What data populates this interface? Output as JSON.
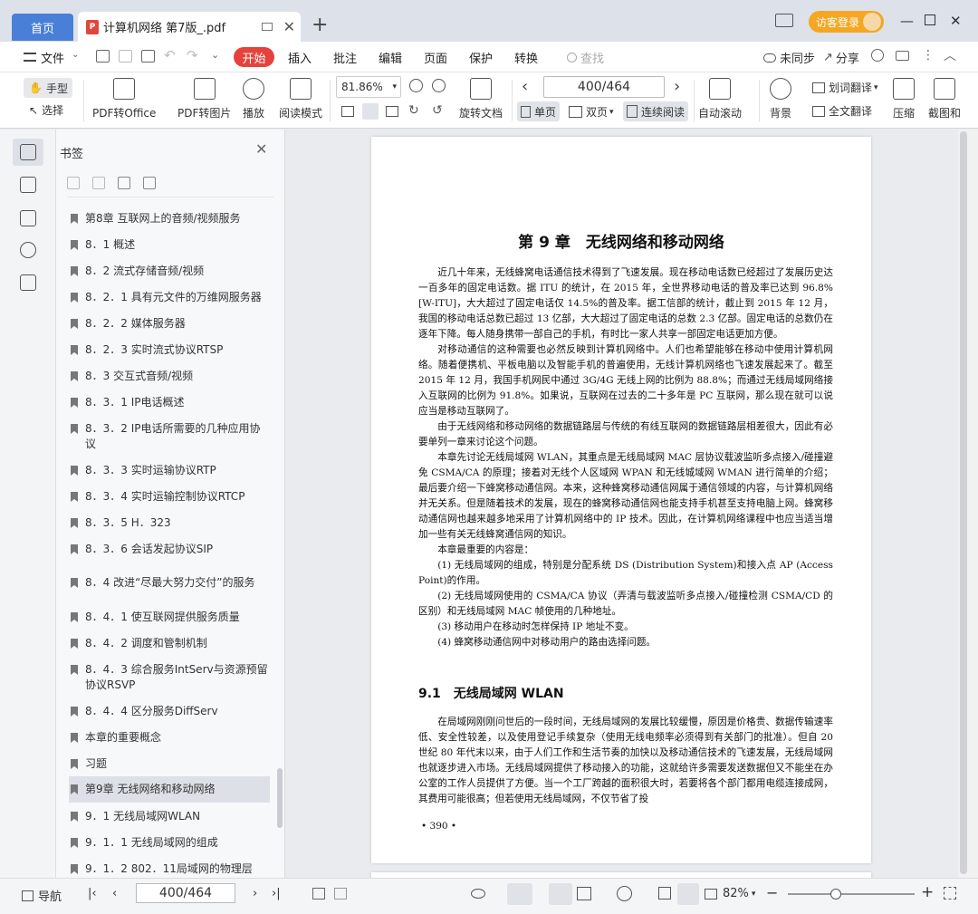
{
  "titlebar": {
    "home_tab": "首页",
    "doc_tab": "计算机网络 第7版_.pdf",
    "visitor_login": "访客登录"
  },
  "menubar": {
    "file": "文件",
    "items": [
      "开始",
      "插入",
      "批注",
      "编辑",
      "页面",
      "保护",
      "转换"
    ],
    "search_placeholder": "查找",
    "sync": "未同步",
    "share": "分享"
  },
  "toolbar": {
    "hand": "手型",
    "select": "选择",
    "pdf_to_office": "PDF转Office",
    "pdf_to_image": "PDF转图片",
    "play": "播放",
    "reading_mode": "阅读模式",
    "zoom": "81.86%",
    "rotate": "旋转文档",
    "page_indicator": "400/464",
    "single_page": "单页",
    "double_page": "双页",
    "continuous": "连续阅读",
    "auto_scroll": "自动滚动",
    "background": "背景",
    "word_translate": "划词翻译",
    "full_translate": "全文翻译",
    "compress": "压缩",
    "screenshot": "截图和"
  },
  "bookmarks": {
    "title": "书签",
    "items": [
      "第8章 互联网上的音频/视频服务",
      "8．1 概述",
      "8．2 流式存储音频/视频",
      "8．2．1 具有元文件的万维网服务器",
      "8．2．2 媒体服务器",
      "8．2．3 实时流式协议RTSP",
      "8．3 交互式音频/视频",
      "8．3．1 IP电话概述",
      "8．3．2 IP电话所需要的几种应用协议",
      "8．3．3 实时运输协议RTP",
      "8．3．4 实时运输控制协议RTCP",
      "8．3．5 H．323",
      "8．3．6 会话发起协议SIP",
      "8．4 改进“尽最大努力交付”的服务",
      "8．4．1 使互联网提供服务质量",
      "8．4．2 调度和管制机制",
      "8．4．3 综合服务IntServ与资源预留协议RSVP",
      "8．4．4 区分服务DiffServ",
      "本章的重要概念",
      "习题",
      "第9章 无线网络和移动网络",
      "9．1 无线局域网WLAN",
      "9．1．1 无线局域网的组成",
      "9．1．2 802．11局域网的物理层"
    ],
    "selected_index": 20
  },
  "document": {
    "chapter_title": "第 9 章　无线网络和移动网络",
    "paragraphs": [
      "近几十年来，无线蜂窝电话通信技术得到了飞速发展。现在移动电话数已经超过了发展历史达一百多年的固定电话数。据 ITU 的统计，在 2015 年，全世界移动电话的普及率已达到 96.8%[W-ITU]，大大超过了固定电话仅 14.5%的普及率。据工信部的统计，截止到 2015 年 12 月，我国的移动电话总数已超过 13 亿部，大大超过了固定电话的总数 2.3 亿部。固定电话的总数仍在逐年下降。每人随身携带一部自己的手机，有时比一家人共享一部固定电话更加方便。",
      "对移动通信的这种需要也必然反映到计算机网络中。人们也希望能够在移动中使用计算机网络。随着便携机、平板电脑以及智能手机的普遍使用，无线计算机网络也飞速发展起来了。截至 2015 年 12 月，我国手机网民中通过 3G/4G 无线上网的比例为 88.8%；而通过无线局域网络接入互联网的比例为 91.8%。如果说，互联网在过去的二十多年是 PC 互联网，那么现在就可以说应当是移动互联网了。",
      "由于无线网络和移动网络的数据链路层与传统的有线互联网的数据链路层相差很大，因此有必要单列一章来讨论这个问题。",
      "本章先讨论无线局域网 WLAN，其重点是无线局域网 MAC 层协议载波监听多点接入/碰撞避免 CSMA/CA 的原理；接着对无线个人区域网 WPAN 和无线城域网 WMAN 进行简单的介绍；最后要介绍一下蜂窝移动通信网。本来，这种蜂窝移动通信网属于通信领域的内容，与计算机网络并无关系。但是随着技术的发展，现在的蜂窝移动通信网也能支持手机甚至支持电脑上网。蜂窝移动通信网也越来越多地采用了计算机网络中的 IP 技术。因此，在计算机网络课程中也应当适当增加一些有关无线蜂窝通信网的知识。",
      "本章最重要的内容是：",
      "(1) 无线局域网的组成，特别是分配系统 DS (Distribution System)和接入点 AP (Access Point)的作用。",
      "(2) 无线局域网使用的 CSMA/CA 协议（弄清与载波监听多点接入/碰撞检测 CSMA/CD 的区别）和无线局域网 MAC 帧使用的几种地址。",
      "(3) 移动用户在移动时怎样保持 IP 地址不变。",
      "(4) 蜂窝移动通信网中对移动用户的路由选择问题。"
    ],
    "section_title": "9.1　无线局域网 WLAN",
    "section_paragraph": "在局域网刚刚问世后的一段时间，无线局域网的发展比较缓慢，原因是价格贵、数据传输速率低、安全性较差，以及使用登记手续复杂（使用无线电频率必须得到有关部门的批准）。但自 20 世纪 80 年代末以来，由于人们工作和生活节奏的加快以及移动通信技术的飞速发展，无线局域网也就逐步进入市场。无线局域网提供了移动接入的功能，这就给许多需要发送数据但又不能坐在办公室的工作人员提供了方便。当一个工厂跨越的面积很大时，若要将各个部门都用电缆连接成网，其费用可能很高；但若使用无线局域网，不仅节省了投",
    "page_number": "• 390 •"
  },
  "statusbar": {
    "nav": "导航",
    "page": "400/464",
    "zoom": "82%"
  }
}
